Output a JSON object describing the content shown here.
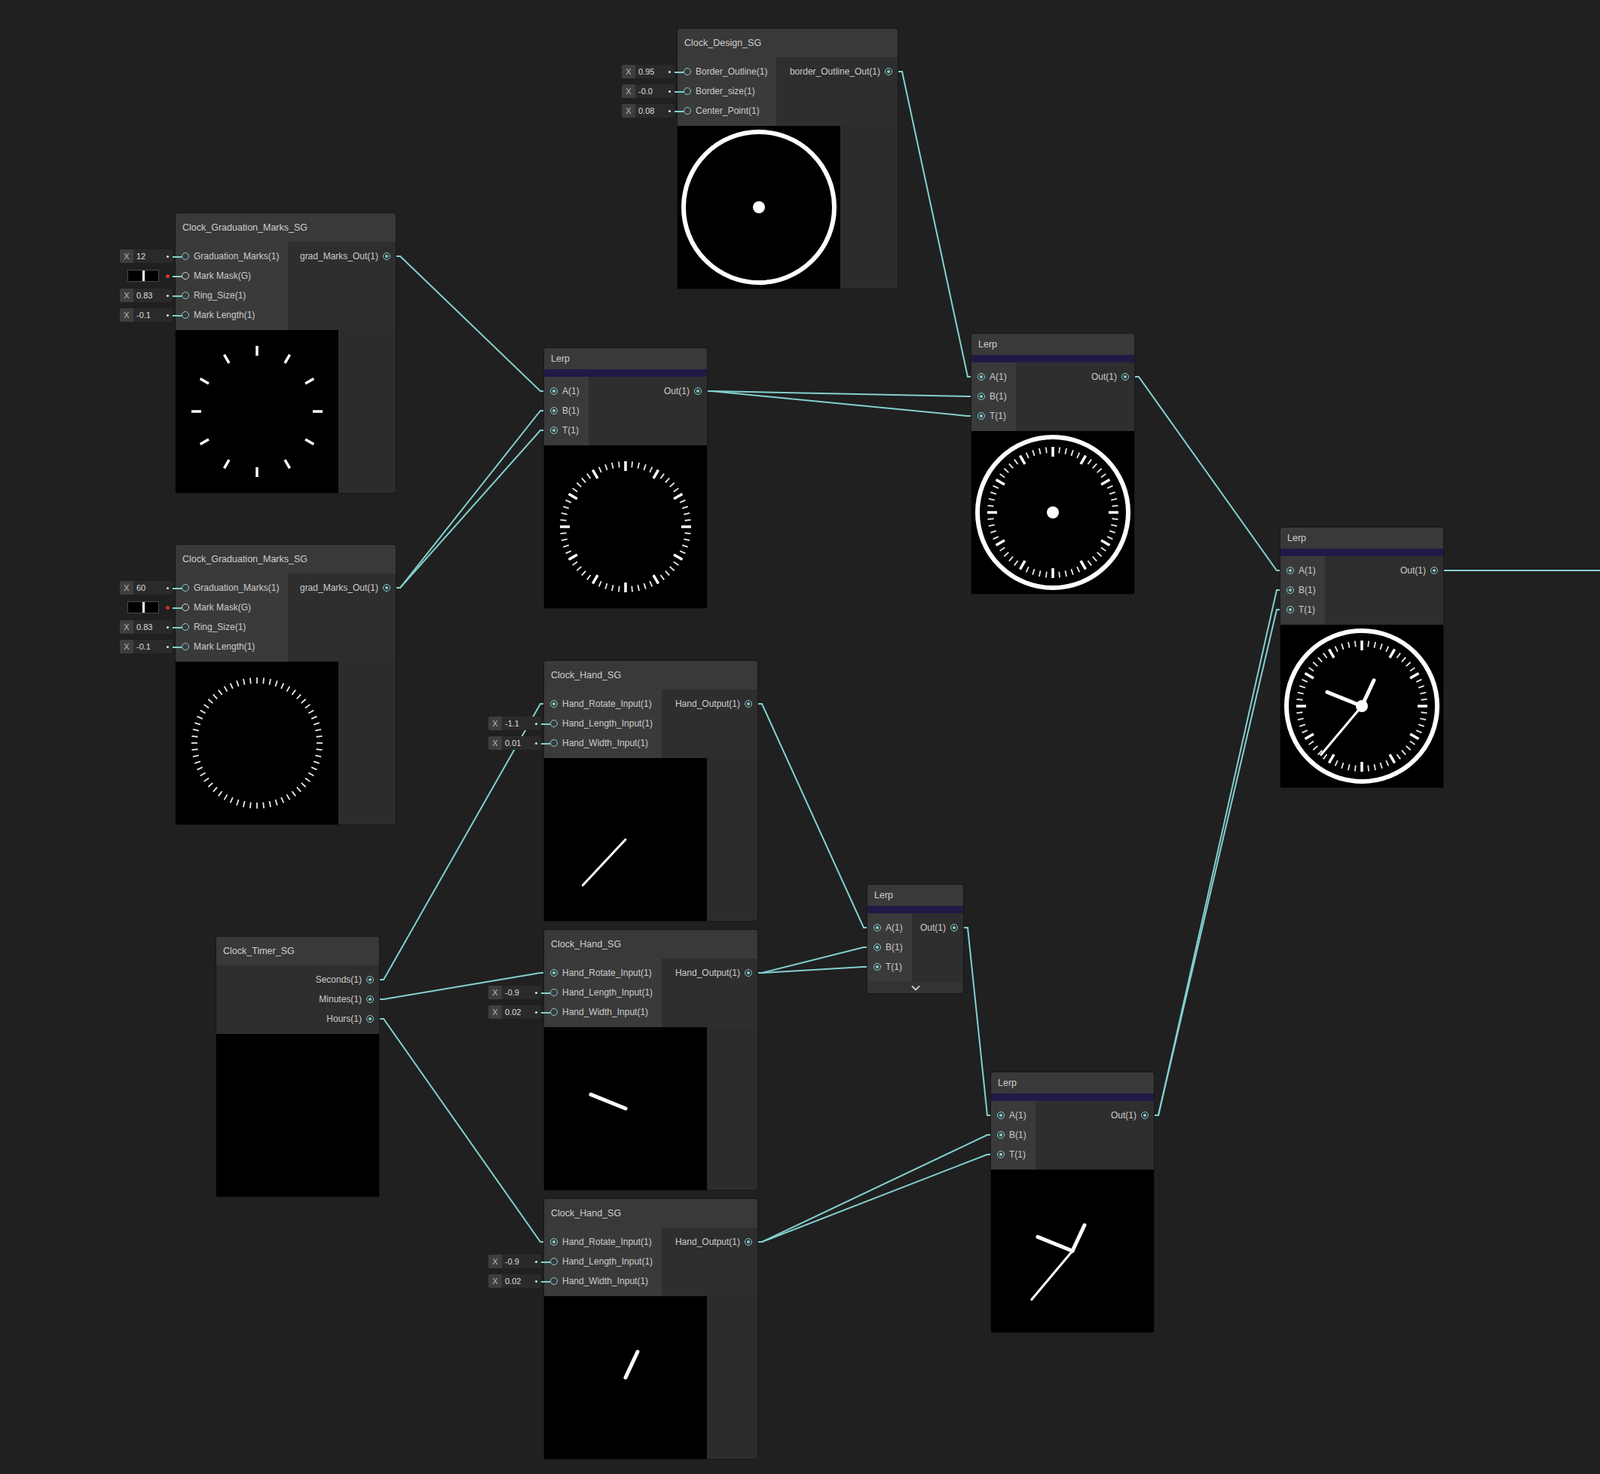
{
  "graph": {
    "nodes": [
      {
        "title": "Clock_Design_SG",
        "kind": "subgraph",
        "collapsed": false,
        "inputs": [
          {
            "label": "Border_Outline(1)",
            "kind": "value",
            "axis": "X",
            "value": "0.95"
          },
          {
            "label": "Border_size(1)",
            "kind": "value",
            "axis": "X",
            "value": "-0.0"
          },
          {
            "label": "Center_Point(1)",
            "kind": "value",
            "axis": "X",
            "value": "0.08"
          }
        ],
        "outputs": [
          {
            "label": "border_Outline_Out(1)"
          }
        ],
        "preview": {
          "layers": [
            "ring",
            "dot"
          ],
          "hands": []
        }
      },
      {
        "title": "Clock_Graduation_Marks_SG",
        "kind": "subgraph",
        "collapsed": false,
        "inputs": [
          {
            "label": "Graduation_Marks(1)",
            "kind": "value",
            "axis": "X",
            "value": "12"
          },
          {
            "label": "Mark Mask(G)",
            "kind": "mask"
          },
          {
            "label": "Ring_Size(1)",
            "kind": "value",
            "axis": "X",
            "value": "0.83"
          },
          {
            "label": "Mark Length(1)",
            "kind": "value",
            "axis": "X",
            "value": "-0.1"
          }
        ],
        "outputs": [
          {
            "label": "grad_Marks_Out(1)"
          }
        ],
        "preview": {
          "layers": [
            "major"
          ],
          "hands": []
        }
      },
      {
        "title": "Clock_Graduation_Marks_SG",
        "kind": "subgraph",
        "collapsed": false,
        "inputs": [
          {
            "label": "Graduation_Marks(1)",
            "kind": "value",
            "axis": "X",
            "value": "60"
          },
          {
            "label": "Mark Mask(G)",
            "kind": "mask"
          },
          {
            "label": "Ring_Size(1)",
            "kind": "value",
            "axis": "X",
            "value": "0.83"
          },
          {
            "label": "Mark Length(1)",
            "kind": "value",
            "axis": "X",
            "value": "-0.1"
          }
        ],
        "outputs": [
          {
            "label": "grad_Marks_Out(1)"
          }
        ],
        "preview": {
          "layers": [
            "minor"
          ],
          "hands": []
        }
      },
      {
        "title": "Lerp",
        "kind": "lerp",
        "collapsed": false,
        "inputs": [
          {
            "label": "A(1)",
            "kind": "port"
          },
          {
            "label": "B(1)",
            "kind": "port"
          },
          {
            "label": "T(1)",
            "kind": "port"
          }
        ],
        "outputs": [
          {
            "label": "Out(1)"
          }
        ],
        "preview": {
          "layers": [
            "minor",
            "major"
          ],
          "hands": []
        }
      },
      {
        "title": "Lerp",
        "kind": "lerp",
        "collapsed": false,
        "inputs": [
          {
            "label": "A(1)",
            "kind": "port"
          },
          {
            "label": "B(1)",
            "kind": "port"
          },
          {
            "label": "T(1)",
            "kind": "port"
          }
        ],
        "outputs": [
          {
            "label": "Out(1)"
          }
        ],
        "preview": {
          "layers": [
            "ring",
            "minor",
            "major",
            "dot"
          ],
          "hands": []
        }
      },
      {
        "title": "Lerp",
        "kind": "lerp",
        "collapsed": false,
        "inputs": [
          {
            "label": "A(1)",
            "kind": "port"
          },
          {
            "label": "B(1)",
            "kind": "port"
          },
          {
            "label": "T(1)",
            "kind": "port"
          }
        ],
        "outputs": [
          {
            "label": "Out(1)"
          }
        ],
        "preview": {
          "layers": [
            "ring",
            "minor",
            "major",
            "dot"
          ],
          "hands": [
            {
              "angle": 220,
              "length": 0.78,
              "width": 3
            },
            {
              "angle": 292,
              "length": 0.46,
              "width": 5
            },
            {
              "angle": 25,
              "length": 0.35,
              "width": 5
            }
          ]
        }
      },
      {
        "title": "Clock_Hand_SG",
        "kind": "subgraph",
        "collapsed": false,
        "inputs": [
          {
            "label": "Hand_Rotate_Input(1)",
            "kind": "port"
          },
          {
            "label": "Hand_Length_Input(1)",
            "kind": "value",
            "axis": "X",
            "value": "-1.1"
          },
          {
            "label": "Hand_Width_Input(1)",
            "kind": "value",
            "axis": "X",
            "value": "0.01"
          }
        ],
        "outputs": [
          {
            "label": "Hand_Output(1)"
          }
        ],
        "preview": {
          "layers": [],
          "hands": [
            {
              "angle": 223,
              "length": 0.77,
              "width": 3
            }
          ]
        }
      },
      {
        "title": "Clock_Hand_SG",
        "kind": "subgraph",
        "collapsed": false,
        "inputs": [
          {
            "label": "Hand_Rotate_Input(1)",
            "kind": "port"
          },
          {
            "label": "Hand_Length_Input(1)",
            "kind": "value",
            "axis": "X",
            "value": "-0.9"
          },
          {
            "label": "Hand_Width_Input(1)",
            "kind": "value",
            "axis": "X",
            "value": "0.02"
          }
        ],
        "outputs": [
          {
            "label": "Hand_Output(1)"
          }
        ],
        "preview": {
          "layers": [],
          "hands": [
            {
              "angle": 292,
              "length": 0.46,
              "width": 5
            }
          ]
        }
      },
      {
        "title": "Clock_Hand_SG",
        "kind": "subgraph",
        "collapsed": false,
        "inputs": [
          {
            "label": "Hand_Rotate_Input(1)",
            "kind": "port"
          },
          {
            "label": "Hand_Length_Input(1)",
            "kind": "value",
            "axis": "X",
            "value": "-0.9"
          },
          {
            "label": "Hand_Width_Input(1)",
            "kind": "value",
            "axis": "X",
            "value": "0.02"
          }
        ],
        "outputs": [
          {
            "label": "Hand_Output(1)"
          }
        ],
        "preview": {
          "layers": [],
          "hands": [
            {
              "angle": 25,
              "length": 0.35,
              "width": 5
            }
          ]
        }
      },
      {
        "title": "Clock_Timer_SG",
        "kind": "subgraph",
        "collapsed": false,
        "inputs": [],
        "outputs": [
          {
            "label": "Seconds(1)"
          },
          {
            "label": "Minutes(1)"
          },
          {
            "label": "Hours(1)"
          }
        ],
        "preview": {
          "layers": [],
          "hands": []
        }
      },
      {
        "title": "Lerp",
        "kind": "lerp",
        "collapsed": true,
        "inputs": [
          {
            "label": "A(1)",
            "kind": "port"
          },
          {
            "label": "B(1)",
            "kind": "port"
          },
          {
            "label": "T(1)",
            "kind": "port"
          }
        ],
        "outputs": [
          {
            "label": "Out(1)"
          }
        ],
        "preview": null
      },
      {
        "title": "Lerp",
        "kind": "lerp",
        "collapsed": false,
        "inputs": [
          {
            "label": "A(1)",
            "kind": "port"
          },
          {
            "label": "B(1)",
            "kind": "port"
          },
          {
            "label": "T(1)",
            "kind": "port"
          }
        ],
        "outputs": [
          {
            "label": "Out(1)"
          }
        ],
        "preview": {
          "layers": [],
          "hands": [
            {
              "angle": 220,
              "length": 0.78,
              "width": 3
            },
            {
              "angle": 292,
              "length": 0.46,
              "width": 5
            },
            {
              "angle": 25,
              "length": 0.35,
              "width": 5
            }
          ]
        }
      }
    ],
    "edges": [
      {
        "from": [
          0,
          0
        ],
        "to": [
          4,
          0
        ]
      },
      {
        "from": [
          1,
          0
        ],
        "to": [
          3,
          0
        ]
      },
      {
        "from": [
          2,
          0
        ],
        "to": [
          3,
          1
        ]
      },
      {
        "from": [
          2,
          0
        ],
        "to": [
          3,
          2
        ]
      },
      {
        "from": [
          3,
          0
        ],
        "to": [
          4,
          1
        ]
      },
      {
        "from": [
          3,
          0
        ],
        "to": [
          4,
          2
        ]
      },
      {
        "from": [
          4,
          0
        ],
        "to": [
          5,
          0
        ]
      },
      {
        "from": [
          9,
          0
        ],
        "to": [
          6,
          0
        ]
      },
      {
        "from": [
          9,
          1
        ],
        "to": [
          7,
          0
        ]
      },
      {
        "from": [
          9,
          2
        ],
        "to": [
          8,
          0
        ]
      },
      {
        "from": [
          6,
          0
        ],
        "to": [
          10,
          0
        ]
      },
      {
        "from": [
          7,
          0
        ],
        "to": [
          10,
          1
        ]
      },
      {
        "from": [
          7,
          0
        ],
        "to": [
          10,
          2
        ]
      },
      {
        "from": [
          10,
          0
        ],
        "to": [
          11,
          0
        ]
      },
      {
        "from": [
          8,
          0
        ],
        "to": [
          11,
          1
        ]
      },
      {
        "from": [
          8,
          0
        ],
        "to": [
          11,
          2
        ]
      },
      {
        "from": [
          11,
          0
        ],
        "to": [
          5,
          1
        ]
      },
      {
        "from": [
          11,
          0
        ],
        "to": [
          5,
          2
        ]
      },
      {
        "from": [
          5,
          0
        ],
        "to": null
      }
    ]
  }
}
